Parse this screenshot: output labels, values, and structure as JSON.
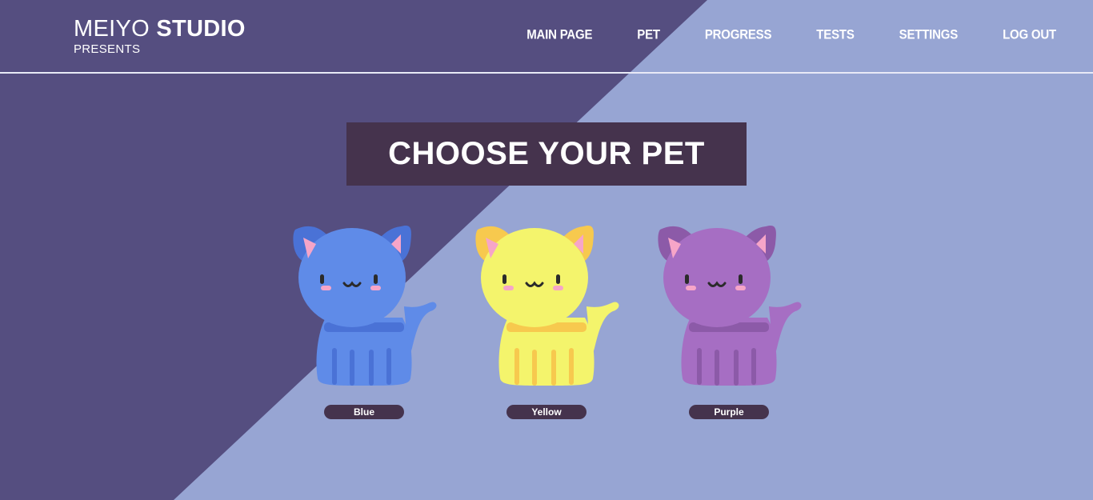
{
  "colors": {
    "bg_dark": "#554e80",
    "bg_light": "#97a5d3",
    "title_box": "#45334d",
    "button": "#45334d"
  },
  "logo": {
    "brand_light": "MEIYO",
    "brand_bold": "STUDIO",
    "subtitle": "PRESENTS"
  },
  "nav": {
    "items": [
      {
        "label": "MAIN PAGE"
      },
      {
        "label": "PET"
      },
      {
        "label": "PROGRESS"
      },
      {
        "label": "TESTS"
      },
      {
        "label": "SETTINGS"
      },
      {
        "label": "LOG OUT"
      }
    ]
  },
  "main": {
    "title": "CHOOSE YOUR PET"
  },
  "pets": [
    {
      "label": "Blue",
      "icon": "blue-cat-icon",
      "body": "#5f8be8",
      "dark": "#4a72d6",
      "ear": "#4a72d6"
    },
    {
      "label": "Yellow",
      "icon": "yellow-cat-icon",
      "body": "#f4f46c",
      "dark": "#f7c94e",
      "ear": "#f7c94e"
    },
    {
      "label": "Purple",
      "icon": "purple-cat-icon",
      "body": "#a66ec3",
      "dark": "#8c5aa8",
      "ear": "#8c5aa8"
    }
  ]
}
